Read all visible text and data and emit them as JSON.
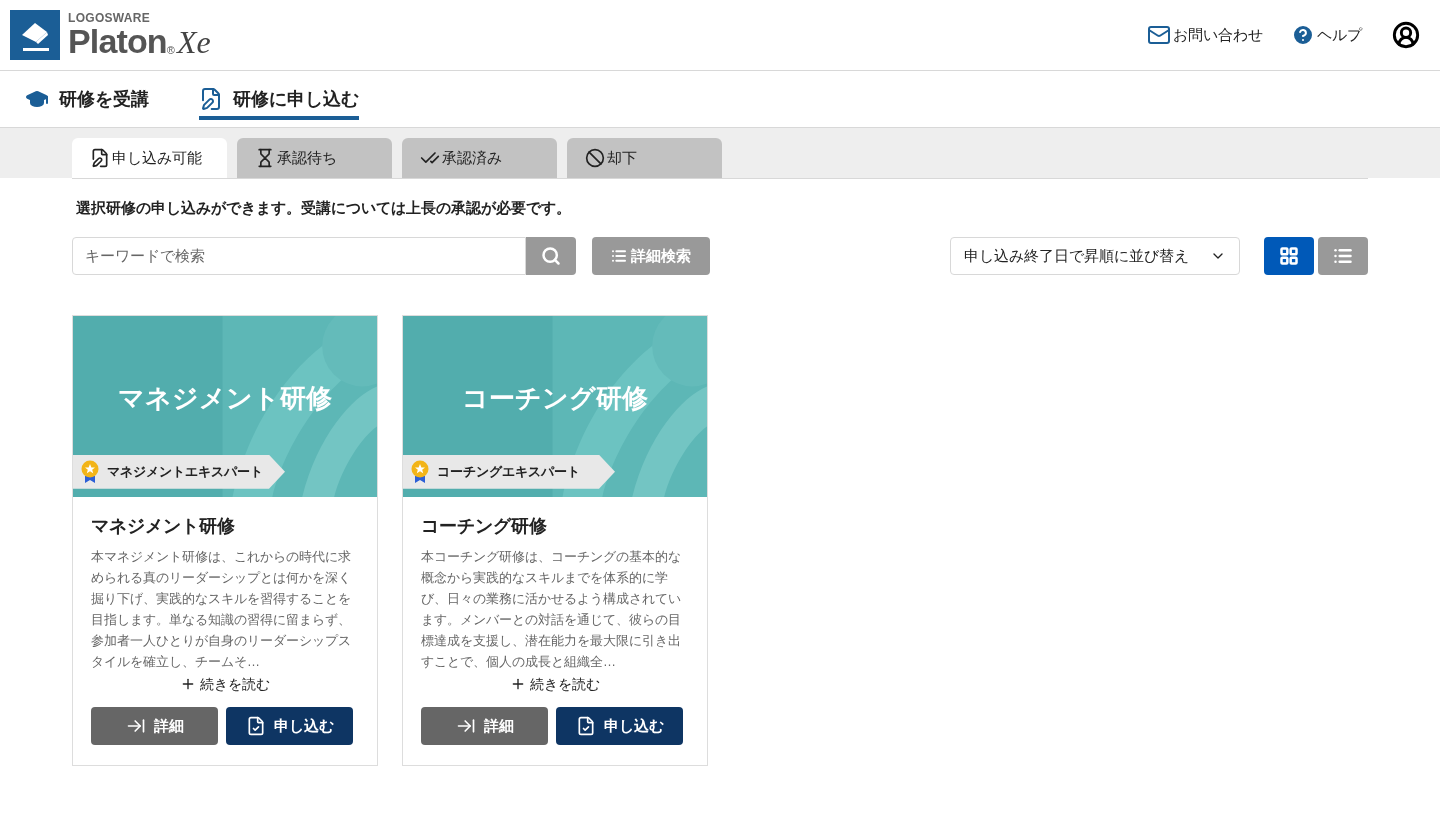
{
  "header": {
    "brand_small": "LOGOSWARE",
    "brand_name": "Platon",
    "brand_reg": "®",
    "brand_suffix": "Xe",
    "links": [
      {
        "kind": "mail",
        "label": "お問い合わせ"
      },
      {
        "kind": "help",
        "label": "ヘルプ"
      }
    ]
  },
  "nav": [
    {
      "kind": "cap",
      "label": "研修を受講",
      "selected": false
    },
    {
      "kind": "apply",
      "label": "研修に申し込む",
      "selected": true
    }
  ],
  "tabs": [
    {
      "kind": "apply",
      "label": "申し込み可能",
      "selected": true
    },
    {
      "kind": "hourglass",
      "label": "承認待ち",
      "selected": false
    },
    {
      "kind": "check",
      "label": "承認済み",
      "selected": false
    },
    {
      "kind": "ban",
      "label": "却下",
      "selected": false
    }
  ],
  "notice": "選択研修の申し込みができます。受講については上長の承認が必要です。",
  "search": {
    "placeholder": "キーワードで検索",
    "advanced": "詳細検索"
  },
  "sort": {
    "value": "申し込み終了日で昇順に並び替え"
  },
  "views": [
    {
      "kind": "grid",
      "selected": true
    },
    {
      "kind": "list",
      "selected": false
    }
  ],
  "cards": [
    {
      "banner": "マネジメント研修",
      "badge": "マネジメントエキスパート",
      "title": "マネジメント研修",
      "description": "本マネジメント研修は、これからの時代に求められる真のリーダーシップとは何かを深く掘り下げ、実践的なスキルを習得することを目指します。単なる知識の習得に留まらず、参加者一人ひとりが自身のリーダーシップスタイルを確立し、チームそ…",
      "more": "続きを読む",
      "details": "詳細",
      "apply": "申し込む"
    },
    {
      "banner": "コーチング研修",
      "badge": "コーチングエキスパート",
      "title": "コーチング研修",
      "description": "本コーチング研修は、コーチングの基本的な概念から実践的なスキルまでを体系的に学び、日々の業務に活かせるよう構成されています。メンバーとの対話を通じて、彼らの目標達成を支援し、潜在能力を最大限に引き出すことで、個人の成長と組織全…",
      "more": "続きを読む",
      "details": "詳細",
      "apply": "申し込む"
    }
  ]
}
